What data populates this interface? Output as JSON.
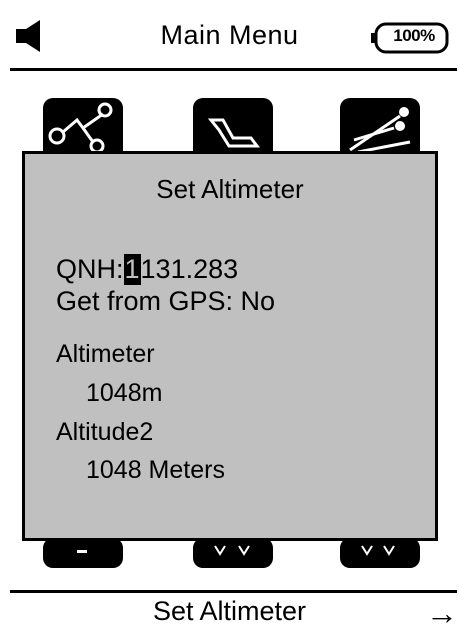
{
  "header": {
    "title": "Main Menu",
    "battery": "100%",
    "speaker_icon": "speaker-icon"
  },
  "menu_icons": [
    "route-icon",
    "glider-icon",
    "thermal-icon"
  ],
  "dialog": {
    "title": "Set Altimeter",
    "qnh_label": "QNH:",
    "qnh_cursor_digit": "1",
    "qnh_rest": "131.283",
    "gps_label": "Get from GPS: No",
    "altimeter_label": "Altimeter",
    "altimeter_value": "1048m",
    "altitude2_label": "Altitude2",
    "altitude2_value": "1048 Meters"
  },
  "footer": {
    "label": "Set Altimeter",
    "arrow": "→"
  },
  "colors": {
    "dialog_bg": "#c0c0c0",
    "foreground": "#000000",
    "background": "#ffffff"
  }
}
